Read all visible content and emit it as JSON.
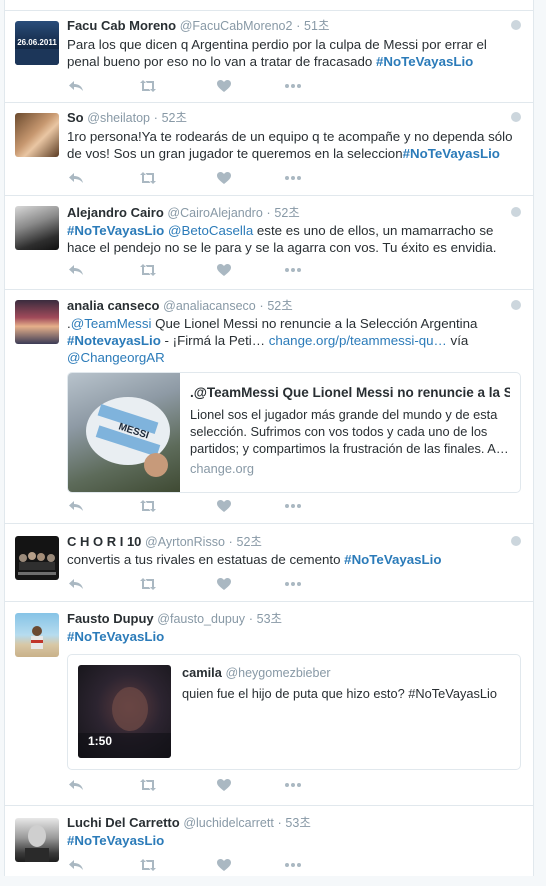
{
  "colors": {
    "link": "#2b7bb9",
    "muted": "#8899a6",
    "text": "#292f33",
    "border": "#e1e8ed",
    "icon": "#aab8c2"
  },
  "tweets": [
    {
      "fullname": "Facu Cab Moreno",
      "username": "@FacuCabMoreno2",
      "time": "51초",
      "avatar_text": "26.06.2011",
      "text_1": "Para los que dicen q Argentina perdio por la culpa de Messi por errar el penal bueno por eso no lo van a tratar de fracasado ",
      "hashtag_1": "#NoTeVayasLio"
    },
    {
      "fullname": "So",
      "username": "@sheilatop",
      "time": "52초",
      "text_1": "1ro persona!Ya te rodearás de un equipo q te acompañe y no dependa sólo de vos! Sos un gran jugador te queremos en la seleccion",
      "hashtag_1": "#NoTeVayasLio"
    },
    {
      "fullname": "Alejandro Cairo",
      "username": "@CairoAlejandro",
      "time": "52초",
      "hashtag_1": "#NoTeVayasLio",
      "mention_1": "@BetoCasella",
      "text_1": " este es uno de ellos, un mamarracho se hace el pendejo no se le para y se la agarra con vos. Tu éxito es envidia."
    },
    {
      "fullname": "analia canseco",
      "username": "@analiacanseco",
      "time": "52초",
      "text_pre": ".",
      "mention_1": "@TeamMessi",
      "text_1": " Que Lionel Messi no renuncie a la Selección Argentina ",
      "hashtag_1": "#NotevayasLio",
      "text_2": " - ¡Firmá la Peti… ",
      "link_1": "change.org/p/teammessi-qu…",
      "text_3": " vía ",
      "mention_2": "@ChangeorgAR",
      "card": {
        "title": ".@TeamMessi Que Lionel Messi no renuncie a la S…",
        "description": "Lionel sos el jugador más grande del mundo y de esta selección. Sufrimos con vos todos y cada uno de los partidos; y compartimos la frustración de las finales. A…",
        "domain": "change.org",
        "jersey_text": "MESSI"
      }
    },
    {
      "fullname": "C H O R I 10",
      "username": "@AyrtonRisso",
      "time": "52초",
      "text_1": "convertis a tus rivales en estatuas de cemento ",
      "hashtag_1": "#NoTeVayasLio"
    },
    {
      "fullname": "Fausto Dupuy",
      "username": "@fausto_dupuy",
      "time": "53초",
      "hashtag_1": "#NoTeVayasLio",
      "quote": {
        "fullname": "camila",
        "username": "@heygomezbieber",
        "text": "quien fue el hijo de puta que hizo esto? #NoTeVayasLio",
        "duration": "1:50"
      }
    },
    {
      "fullname": "Luchi Del Carretto",
      "username": "@luchidelcarrett",
      "time": "53초",
      "hashtag_1": "#NoTeVayasLio"
    }
  ],
  "icons": {
    "reply": "reply-icon",
    "retweet": "retweet-icon",
    "like": "heart-icon",
    "more": "more-icon",
    "geo": "globe-icon"
  }
}
